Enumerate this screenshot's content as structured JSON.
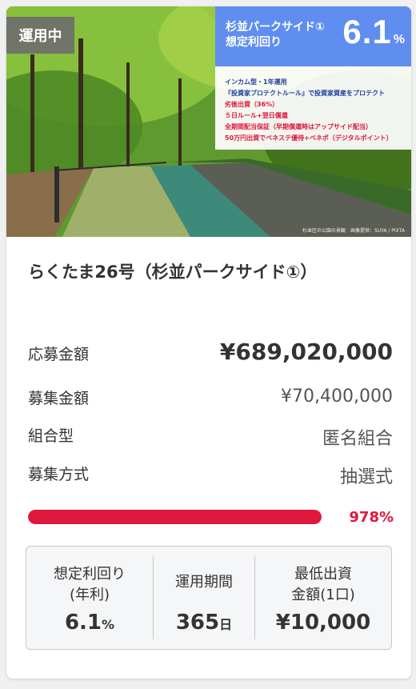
{
  "card": {
    "status_badge": "運用中",
    "panel": {
      "name_line1": "杉並パークサイド①",
      "name_line2": "想定利回り",
      "rate": "6.1",
      "rate_unit": "%"
    },
    "features": [
      {
        "text": "インカム型・1年運用",
        "color": "#1f3f9e"
      },
      {
        "text": "『投資家プロテクトルール』で投資家資産をプロテクト",
        "color": "#1f3f9e"
      },
      {
        "text": "劣後出資（36%）",
        "color": "#e0173d"
      },
      {
        "text": "５日ルール+翌日償還",
        "color": "#e0173d"
      },
      {
        "text": "全期間配当保証（早期償還時はアップサイド配当）",
        "color": "#e0173d"
      },
      {
        "text": "50万円出資でベネステ優待+ベネポ（デジタルポイント）",
        "color": "#e0173d"
      }
    ],
    "photo_credit": "杉並区の公園の景観　画像提供：SUYA / PIXTA",
    "title": "らくたま26号（杉並パークサイド①）",
    "details": [
      {
        "label": "応募金額",
        "value": "¥689,020,000"
      },
      {
        "label": "募集金額",
        "value": "¥70,400,000"
      },
      {
        "label": "組合型",
        "value": "匿名組合"
      },
      {
        "label": "募集方式",
        "value": "抽選式"
      }
    ],
    "progress": {
      "percent": 978,
      "label": "978%"
    },
    "stats": [
      {
        "label_line1": "想定利回り",
        "label_line2": "(年利)",
        "value": "6.1",
        "unit": "%"
      },
      {
        "label_line1": "運用期間",
        "label_line2": "",
        "value": "365",
        "unit": "日"
      },
      {
        "label_line1": "最低出資",
        "label_line2": "金額(1口)",
        "value": "¥10,000",
        "unit": ""
      }
    ]
  },
  "colors": {
    "accent_blue": "#5f8ef0",
    "progress_red": "#e0173d"
  }
}
